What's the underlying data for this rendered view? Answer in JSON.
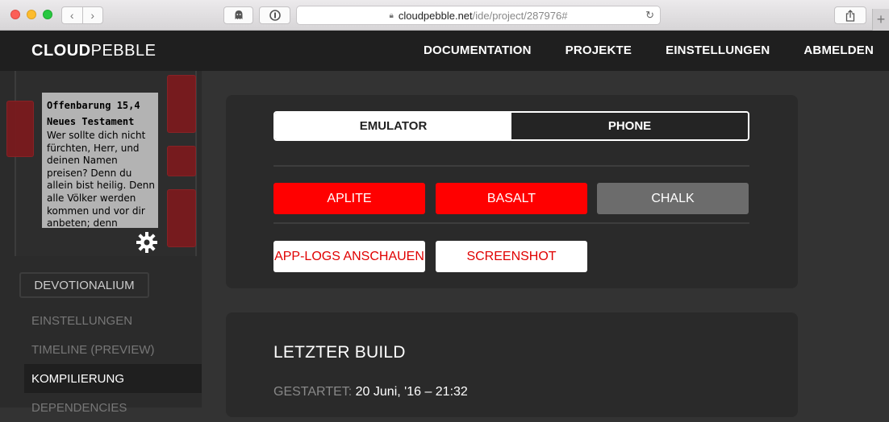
{
  "browser": {
    "url_domain": "cloudpebble.net",
    "url_path": "/ide/project/287976#"
  },
  "header": {
    "logo_bold": "CLOUD",
    "logo_light": "PEBBLE",
    "nav": [
      "DOCUMENTATION",
      "PROJEKTE",
      "EINSTELLUNGEN",
      "ABMELDEN"
    ]
  },
  "watch": {
    "title1": "Offenbarung 15,4",
    "title2": "Neues Testament",
    "body": "Wer sollte dich nicht fürchten, Herr, und deinen Namen preisen? Denn du allein bist heilig. Denn alle Völker werden kommen und vor dir anbeten; denn"
  },
  "sidebar": {
    "project_name": "DEVOTIONALIUM",
    "items": [
      {
        "label": "EINSTELLUNGEN"
      },
      {
        "label": "TIMELINE (PREVIEW)"
      },
      {
        "label": "KOMPILIERUNG"
      },
      {
        "label": "DEPENDENCIES"
      }
    ]
  },
  "main": {
    "seg_emulator": "EMULATOR",
    "seg_phone": "PHONE",
    "platforms": [
      "APLITE",
      "BASALT",
      "CHALK"
    ],
    "app_logs": "APP-LOGS ANSCHAUEN",
    "screenshot": "SCREENSHOT",
    "build_title": "LETZTER BUILD",
    "started_label": "GESTARTET:",
    "started_value": "20 Juni, '16 – 21:32"
  },
  "colors": {
    "accent_red": "#ff0000",
    "watch_button": "#7a1b1e"
  }
}
